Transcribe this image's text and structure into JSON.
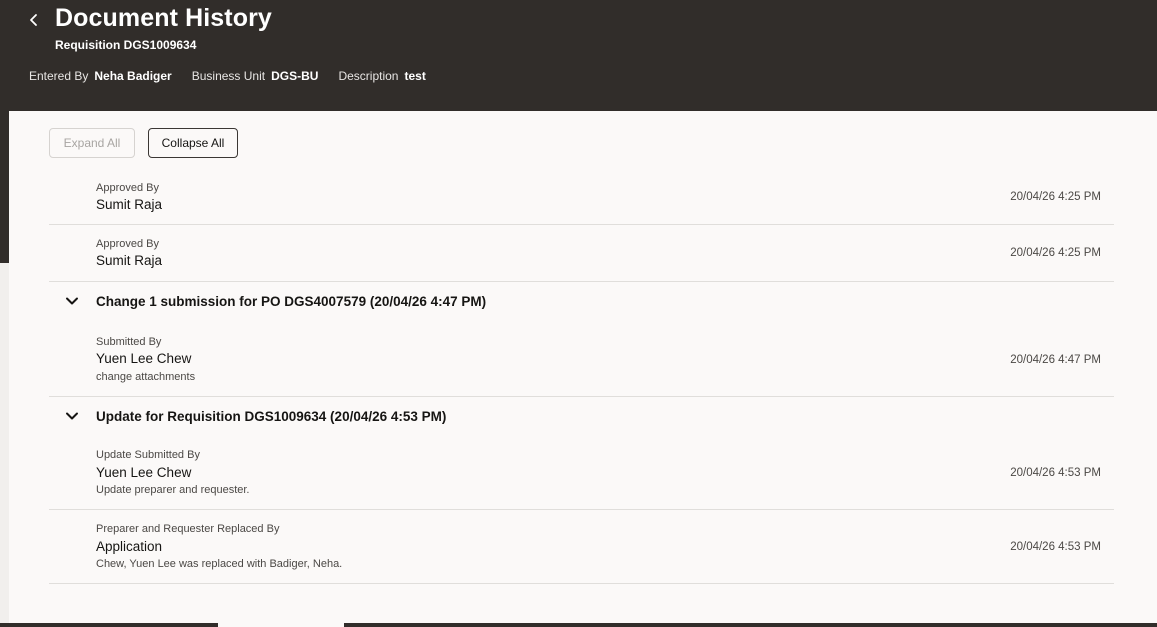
{
  "header": {
    "title": "Document History",
    "subtitle": "Requisition DGS1009634",
    "meta": [
      {
        "label": "Entered By",
        "value": "Neha Badiger"
      },
      {
        "label": "Business Unit",
        "value": "DGS-BU"
      },
      {
        "label": "Description",
        "value": "test"
      }
    ]
  },
  "toolbar": {
    "expand_label": "Expand All",
    "collapse_label": "Collapse All"
  },
  "history": {
    "top_entries": [
      {
        "label": "Approved By",
        "name": "Sumit Raja",
        "time": "20/04/26 4:25 PM"
      },
      {
        "label": "Approved By",
        "name": "Sumit Raja",
        "time": "20/04/26 4:25 PM"
      }
    ],
    "groups": [
      {
        "title": "Change 1 submission for PO DGS4007579 (20/04/26 4:47 PM)",
        "entries": [
          {
            "label": "Submitted By",
            "name": "Yuen Lee Chew",
            "note": "change attachments",
            "time": "20/04/26 4:47 PM"
          }
        ]
      },
      {
        "title": "Update for Requisition DGS1009634 (20/04/26 4:53 PM)",
        "entries": [
          {
            "label": "Update Submitted By",
            "name": "Yuen Lee Chew",
            "note": "Update preparer and requester.",
            "time": "20/04/26 4:53 PM"
          },
          {
            "label": "Preparer and Requester Replaced By",
            "name": "Application",
            "note": "Chew, Yuen Lee was replaced with Badiger, Neha.",
            "time": "20/04/26 4:53 PM"
          }
        ]
      }
    ]
  },
  "icons": {
    "back": "chevron-left-icon",
    "group_toggle": "chevron-down-icon"
  }
}
